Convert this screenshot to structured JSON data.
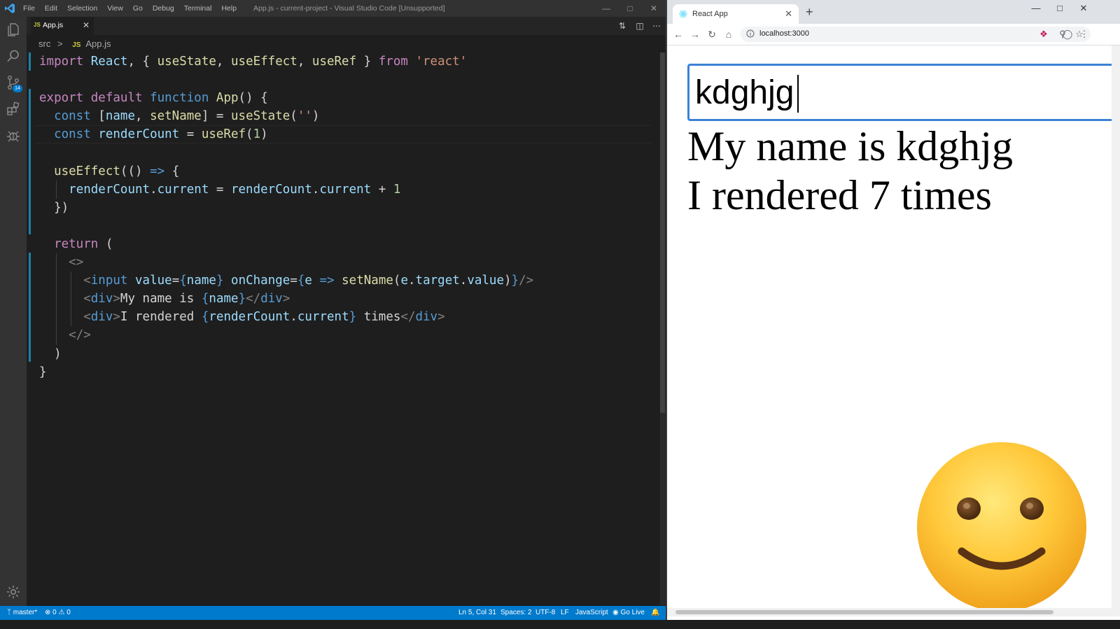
{
  "vscode": {
    "menu": [
      "File",
      "Edit",
      "Selection",
      "View",
      "Go",
      "Debug",
      "Terminal",
      "Help"
    ],
    "window_title": "App.js - current-project - Visual Studio Code [Unsupported]",
    "source_control_badge": "14",
    "tab": {
      "badge": "JS",
      "label": "App.js"
    },
    "breadcrumb": {
      "folder": "src",
      "sep": ">",
      "badge": "JS",
      "file": "App.js"
    },
    "status": {
      "branch": "master*",
      "errors": "0",
      "warnings": "0",
      "position": "Ln 5, Col 31",
      "spaces": "Spaces: 2",
      "encoding": "UTF-8",
      "eol": "LF",
      "language": "JavaScript",
      "golive": "Go Live"
    },
    "code_lines": [
      "import React, { useState, useEffect, useRef } from 'react'",
      "",
      "export default function App() {",
      "  const [name, setName] = useState('')",
      "  const renderCount = useRef(1)",
      "",
      "  useEffect(() => {",
      "    renderCount.current = renderCount.current + 1",
      "  })",
      "",
      "  return (",
      "    <>",
      "      <input value={name} onChange={e => setName(e.target.value)}/>",
      "      <div>My name is {name}</div>",
      "      <div>I rendered {renderCount.current} times</div>",
      "    </>",
      "  )",
      "}"
    ]
  },
  "browser": {
    "tab_title": "React App",
    "url": "localhost:3000",
    "input_value": "kdghjg",
    "name_line": "My name is kdghjg",
    "render_line": "I rendered 7 times"
  },
  "colors": {
    "editor_bg": "#1e1e1e",
    "status_bar": "#007acc",
    "input_focus": "#3b82d6",
    "keyword": "#c586c0",
    "storage": "#569cd6",
    "function": "#dcdcaa",
    "variable": "#9cdcfe",
    "string": "#ce9178"
  },
  "icons": [
    "vscode-logo-icon",
    "explorer-icon",
    "search-icon",
    "source-control-icon",
    "extensions-icon",
    "debug-icon",
    "settings-gear-icon",
    "react-favicon-icon",
    "smiley-emoji-icon"
  ]
}
